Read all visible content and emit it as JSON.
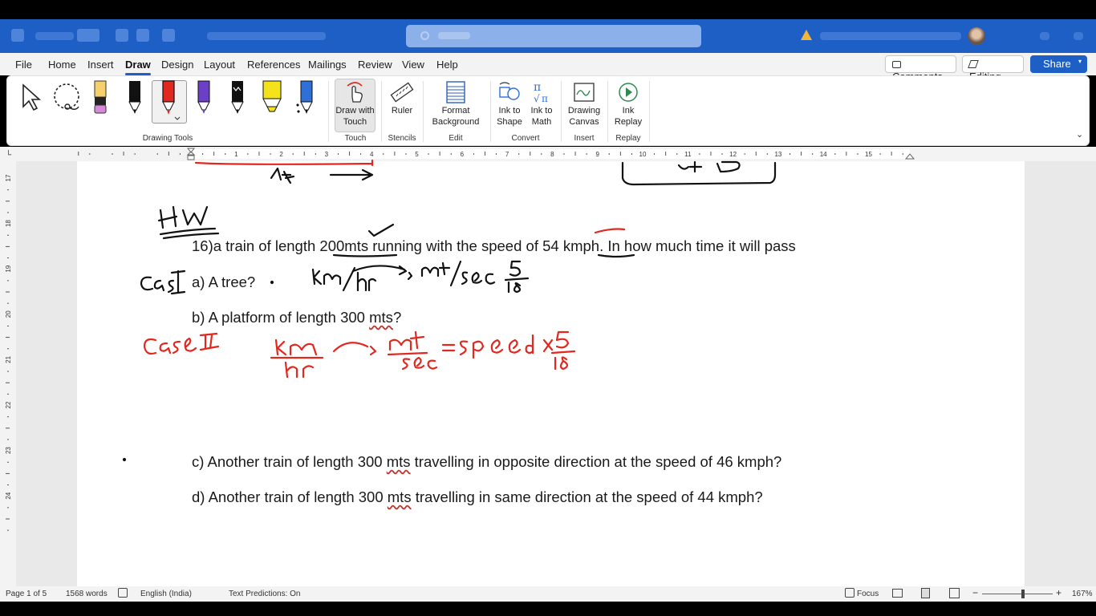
{
  "ribbon_tabs": [
    "File",
    "Home",
    "Insert",
    "Draw",
    "Design",
    "Layout",
    "References",
    "Mailings",
    "Review",
    "View",
    "Help"
  ],
  "active_tab": "Draw",
  "top_right": {
    "comments": "Comments",
    "editing": "Editing",
    "share": "Share"
  },
  "ribbon": {
    "draw_with_touch_1": "Draw with",
    "draw_with_touch_2": "Touch",
    "ruler": "Ruler",
    "format_bg_1": "Format",
    "format_bg_2": "Background",
    "ink_shape_1": "Ink to",
    "ink_shape_2": "Shape",
    "ink_math_1": "Ink to",
    "ink_math_2": "Math",
    "drawing_canvas_1": "Drawing",
    "drawing_canvas_2": "Canvas",
    "ink_replay_1": "Ink",
    "ink_replay_2": "Replay",
    "groups": {
      "drawing_tools": "Drawing Tools",
      "touch": "Touch",
      "stencils": "Stencils",
      "edit": "Edit",
      "convert": "Convert",
      "insert": "Insert",
      "replay": "Replay"
    }
  },
  "ruler_numbers": [
    "1",
    "2",
    "3",
    "4",
    "5",
    "6",
    "7",
    "8",
    "9",
    "10",
    "11",
    "12",
    "13",
    "14",
    "15"
  ],
  "vruler_numbers": [
    "17",
    "18",
    "19",
    "20",
    "21",
    "22",
    "23",
    "24"
  ],
  "document": {
    "q16_pre": "16)a train of length ",
    "q16_mts": "200mts",
    "q16_mid": " running with the speed of 54 ",
    "q16_kmph": "kmph",
    "q16_post": ". In how much time it will pass",
    "qa": "a) A tree?",
    "qb_pre": "b) A platform of length 300 ",
    "qb_mts": "mts",
    "qb_post": "?",
    "qc_pre": "c) Another train of length 300 ",
    "qc_mts": "mts",
    "qc_post": " travelling in opposite direction at the speed of 46 kmph?",
    "qd_pre": "d) Another train of length 300 ",
    "qd_mts": "mts",
    "qd_post": " travelling in same direction at the speed of 44 kmph?"
  },
  "status": {
    "page": "Page 1 of 5",
    "words": "1568 words",
    "language": "English (India)",
    "predictions": "Text Predictions: On",
    "focus": "Focus",
    "zoom": "167%"
  },
  "colors": {
    "accent": "#1d5fc4",
    "ink_red": "#e0281f",
    "ink_black": "#111111"
  }
}
